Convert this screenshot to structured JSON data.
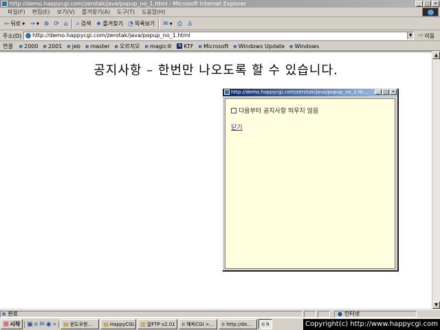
{
  "window": {
    "title": "http://demo.happycgi.com/zerotak/java/popup_no_1.html - Microsoft Internet Explorer"
  },
  "menu": [
    "파일(F)",
    "편집(E)",
    "보기(V)",
    "즐겨찾기(A)",
    "도구(T)",
    "도움말(H)"
  ],
  "toolbar": {
    "back": "뒤로",
    "forward": "→",
    "search": "검색",
    "favorites": "즐겨찾기",
    "history": "목록보기"
  },
  "address": {
    "label": "주소(D)",
    "url": "http://demo.happycgi.com/zerotak/java/popup_no_1.html",
    "go": "이동"
  },
  "links": {
    "label": "연결",
    "items": [
      "2000",
      "2001",
      "jeb",
      "master",
      "오르지오",
      "magic®",
      "KTF",
      "Microsoft",
      "Windows Update",
      "Windows"
    ]
  },
  "page": {
    "heading": "공지사항 – 한번만 나오도록 할 수 있습니다."
  },
  "popup": {
    "title": "http://demo.happycgi.com/zerotak/java/popup_no_2.ht...",
    "checkbox_label": "다음부터 공지사항 띄우지 않음",
    "close_link": "닫기"
  },
  "status": {
    "text": "완료",
    "zone": "인터넷"
  },
  "taskbar": {
    "start": "시작",
    "tasks": [
      "윈도우창...",
      "HappyCGI...",
      "알FTP v2.01",
      "해피CGI >...",
      "http://de...",
      "h"
    ],
    "copyright": "Copyright(c) http://www.happycgi.com"
  }
}
